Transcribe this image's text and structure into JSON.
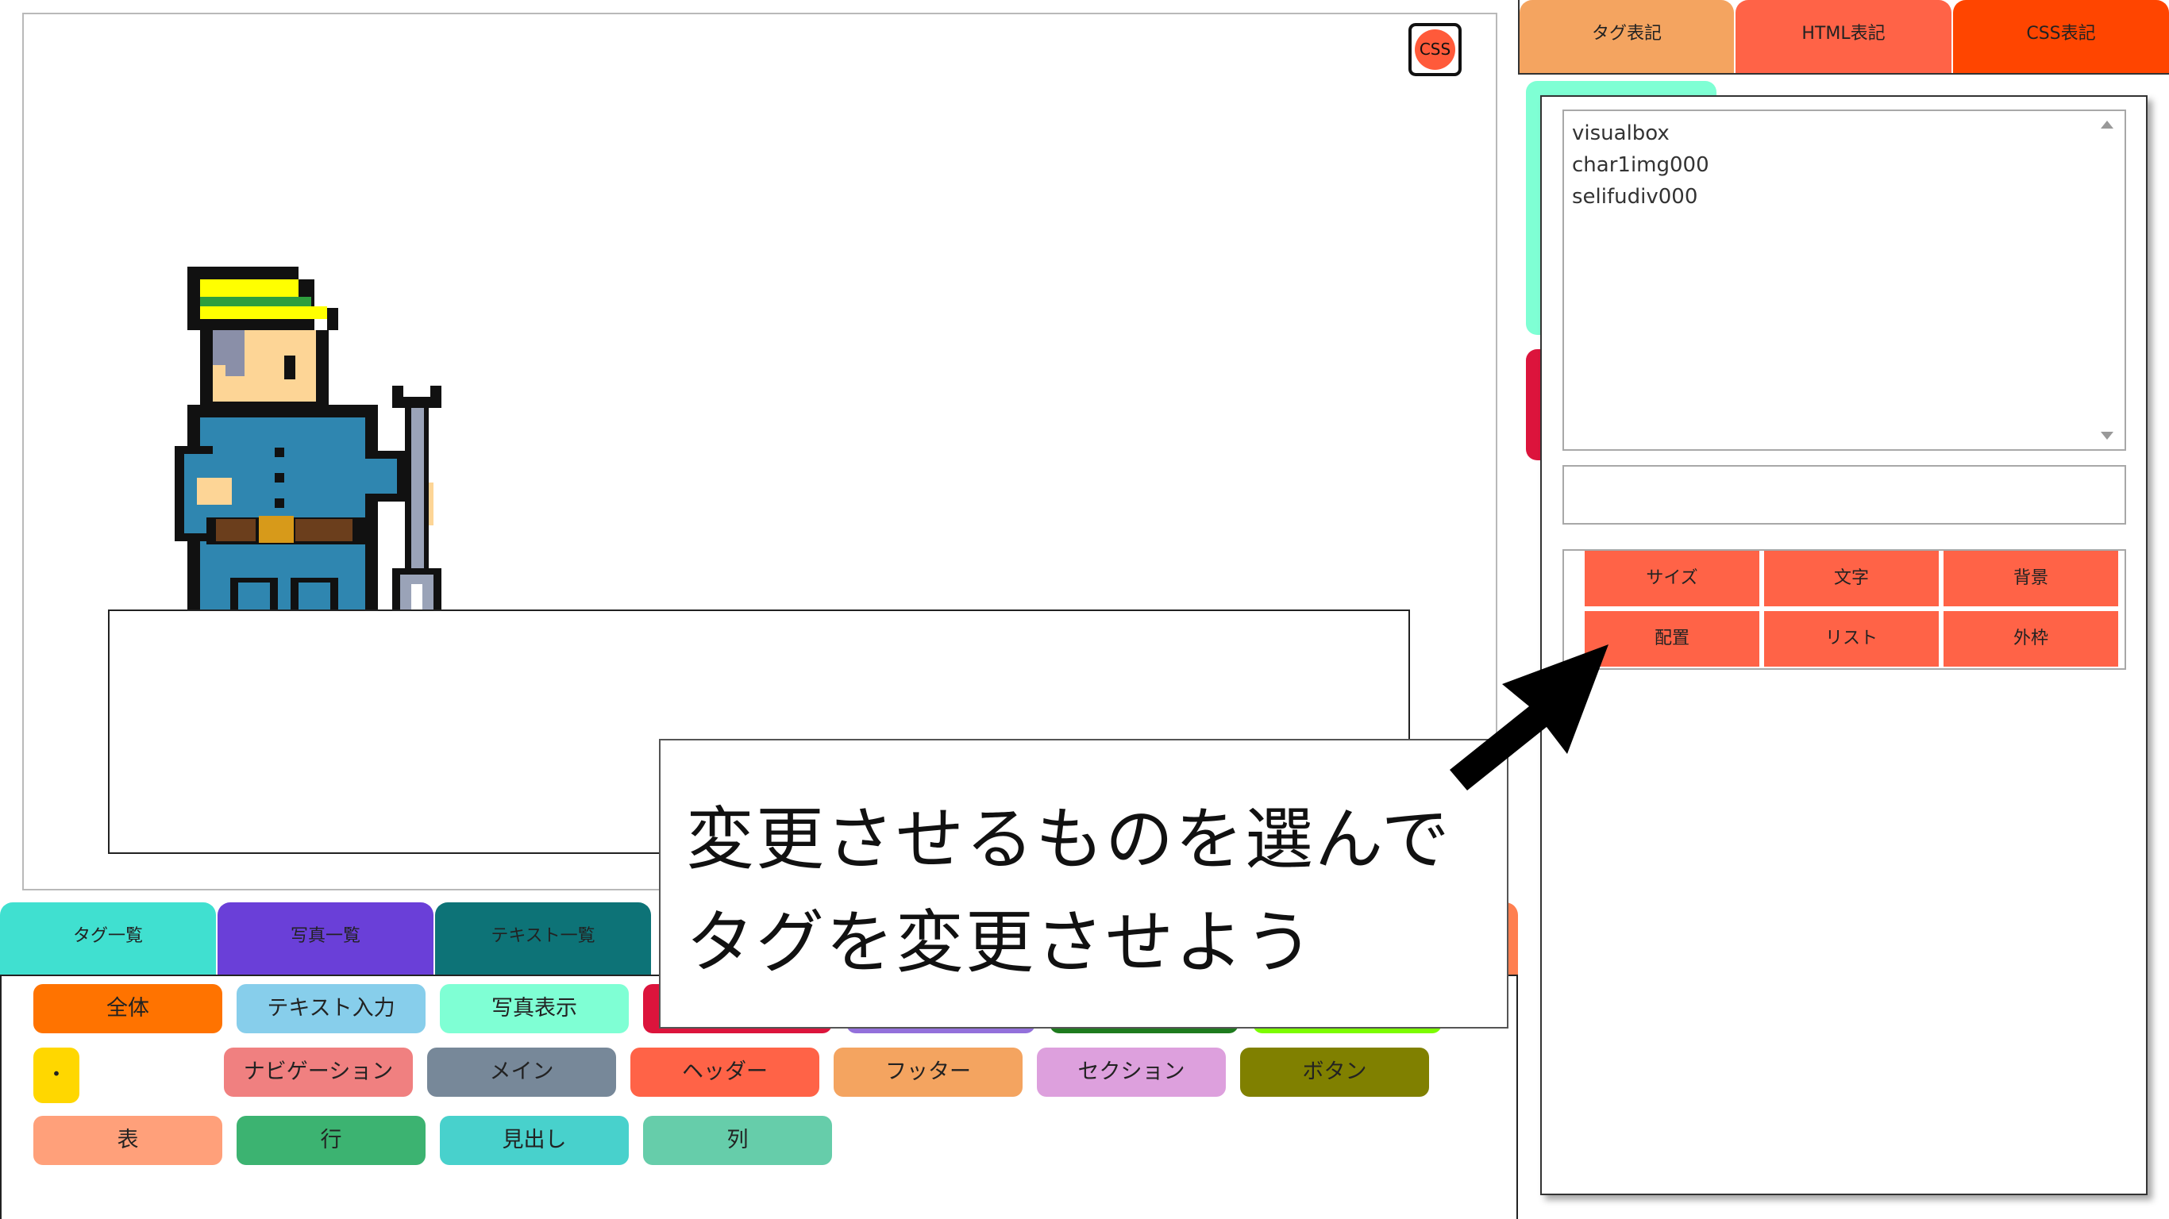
{
  "stage": {
    "badge_label": "CSS"
  },
  "tooltip": {
    "line1": "変更させるものを選んで",
    "line2": "タグを変更させよう"
  },
  "bottom_tabs": [
    {
      "label": "タグ一覧",
      "color": "#40e0d0"
    },
    {
      "label": "写真一覧",
      "color": "#6a3fd8"
    },
    {
      "label": "テキスト一覧",
      "color": "#0d7377"
    }
  ],
  "tag_chips": [
    {
      "label": "全体",
      "color": "#ff7300"
    },
    {
      "label": "テキスト入力",
      "color": "#87ceeb"
    },
    {
      "label": "写真表示",
      "color": "#7fffd4"
    },
    {
      "label": "",
      "color": "#dc143c"
    },
    {
      "label": "",
      "color": "#9370db"
    },
    {
      "label": "",
      "color": "#1e7b1e"
    },
    {
      "label": "",
      "color": "#7cfc00"
    },
    {
      "label": "・",
      "color": "#ffd700"
    },
    {
      "label": "ナビゲーション",
      "color": "#f08080"
    },
    {
      "label": "メイン",
      "color": "#778899"
    },
    {
      "label": "ヘッダー",
      "color": "#ff6347"
    },
    {
      "label": "フッター",
      "color": "#f4a460"
    },
    {
      "label": "セクション",
      "color": "#dda0dd"
    },
    {
      "label": "ボタン",
      "color": "#808000"
    },
    {
      "label": "表",
      "color": "#ffa07a"
    },
    {
      "label": "行",
      "color": "#3cb371"
    },
    {
      "label": "見出し",
      "color": "#48d1cc"
    },
    {
      "label": "列",
      "color": "#66cdaa"
    }
  ],
  "right_tabs": [
    {
      "label": "タグ表記",
      "color": "#f4a460"
    },
    {
      "label": "HTML表記",
      "color": "#ff6347"
    },
    {
      "label": "CSS表記",
      "color": "#ff4500"
    }
  ],
  "element_list": [
    "visualbox",
    "char1img000",
    "selifudiv000"
  ],
  "property_input": {
    "value": "",
    "placeholder": ""
  },
  "property_buttons": [
    "サイズ",
    "文字",
    "背景",
    "配置",
    "リスト",
    "外枠"
  ],
  "colors": {
    "accent": "#ff6347",
    "side_tab_mint": "#7fffd4",
    "side_tab_red": "#dc143c"
  }
}
